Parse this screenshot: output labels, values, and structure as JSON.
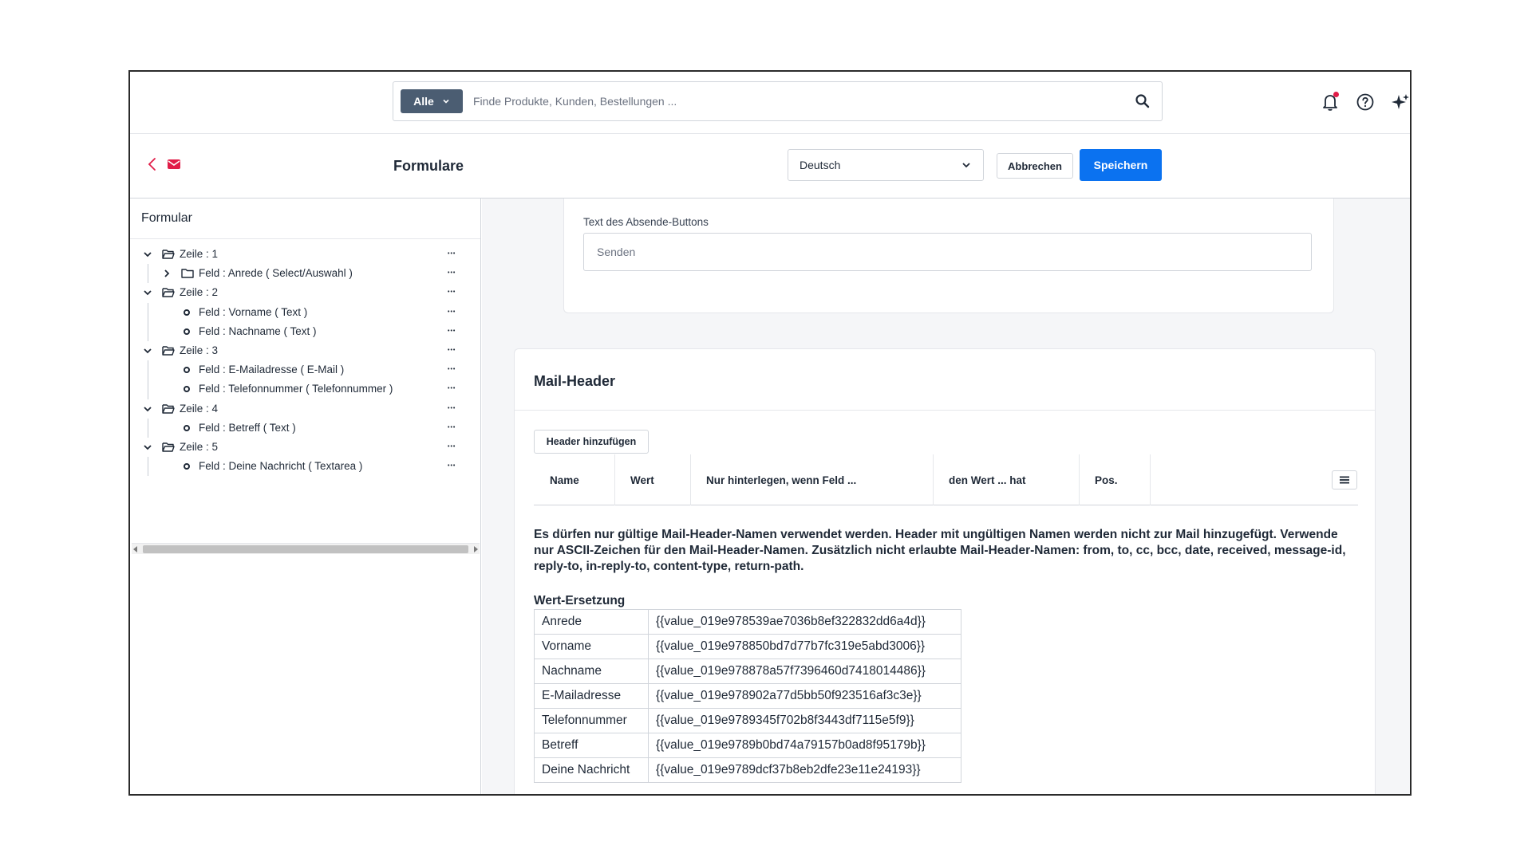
{
  "topbar": {
    "scope_label": "Alle",
    "search_placeholder": "Finde Produkte, Kunden, Bestellungen ..."
  },
  "subheader": {
    "title": "Formulare",
    "language": "Deutsch",
    "cancel_label": "Abbrechen",
    "save_label": "Speichern"
  },
  "tree": {
    "title": "Formular",
    "items": [
      {
        "label": "Zeile : 1",
        "level": 0,
        "kind": "folder",
        "expanded": true
      },
      {
        "label": "Feld : Anrede ( Select/Auswahl )",
        "level": 1,
        "kind": "folder",
        "expanded": false
      },
      {
        "label": "Zeile : 2",
        "level": 0,
        "kind": "folder",
        "expanded": true
      },
      {
        "label": "Feld : Vorname ( Text )",
        "level": 1,
        "kind": "field"
      },
      {
        "label": "Feld : Nachname ( Text )",
        "level": 1,
        "kind": "field"
      },
      {
        "label": "Zeile : 3",
        "level": 0,
        "kind": "folder",
        "expanded": true
      },
      {
        "label": "Feld : E-Mailadresse ( E-Mail )",
        "level": 1,
        "kind": "field"
      },
      {
        "label": "Feld : Telefonnummer ( Telefonnummer )",
        "level": 1,
        "kind": "field"
      },
      {
        "label": "Zeile : 4",
        "level": 0,
        "kind": "folder",
        "expanded": true
      },
      {
        "label": "Feld : Betreff ( Text )",
        "level": 1,
        "kind": "field"
      },
      {
        "label": "Zeile : 5",
        "level": 0,
        "kind": "folder",
        "expanded": true
      },
      {
        "label": "Feld : Deine Nachricht ( Textarea )",
        "level": 1,
        "kind": "field"
      }
    ]
  },
  "send_card": {
    "label": "Text des Absende-Buttons",
    "placeholder": "Senden"
  },
  "mail_header": {
    "title": "Mail-Header",
    "add_label": "Header hinzufügen",
    "columns": [
      "Name",
      "Wert",
      "Nur hinterlegen, wenn Feld ...",
      "den Wert ... hat",
      "Pos."
    ],
    "info": "Es dürfen nur gültige Mail-Header-Namen verwendet werden. Header mit ungültigen Namen werden nicht zur Mail hinzugefügt. Verwende nur ASCII-Zeichen für den Mail-Header-Namen. Zusätzlich nicht erlaubte Mail-Header-Namen: from, to, cc, bcc, date, received, message-id, reply-to, in-reply-to, content-type, return-path.",
    "replacement_title": "Wert-Ersetzung",
    "replacements": [
      {
        "name": "Anrede",
        "value": "{{value_019e978539ae7036b8ef322832dd6a4d}}"
      },
      {
        "name": "Vorname",
        "value": "{{value_019e978850bd7d77b7fc319e5abd3006}}"
      },
      {
        "name": "Nachname",
        "value": "{{value_019e978878a57f7396460d7418014486}}"
      },
      {
        "name": "E-Mailadresse",
        "value": "{{value_019e978902a77d5bb50f923516af3c3e}}"
      },
      {
        "name": "Telefonnummer",
        "value": "{{value_019e9789345f702b8f3443df7115e5f9}}"
      },
      {
        "name": "Betreff",
        "value": "{{value_019e9789b0bd74a79157b0ad8f95179b}}"
      },
      {
        "name": "Deine Nachricht",
        "value": "{{value_019e9789dcf37b8eb2dfe23e11e24193}}"
      }
    ]
  },
  "colors": {
    "primary": "#0b72f0",
    "scope_button": "#4b5d72",
    "accent_red": "#e11d48",
    "content_bg": "#f5f6f8"
  },
  "icons": [
    "search-icon",
    "bell-icon",
    "help-icon",
    "sparkle-icon",
    "back-icon",
    "mail-icon",
    "chevron-down-icon",
    "folder-icon",
    "more-icon",
    "menu-icon"
  ]
}
